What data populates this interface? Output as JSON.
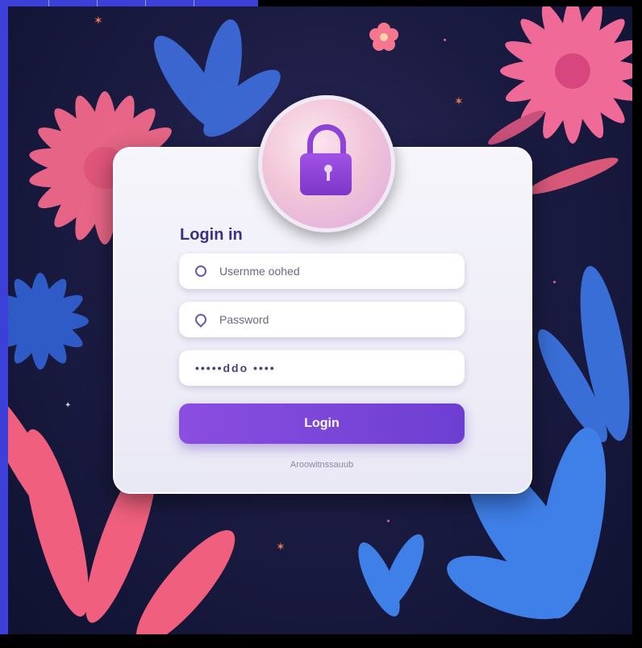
{
  "colors": {
    "accent": "#7b3fd6",
    "title": "#3b2f86",
    "background": "#1c1c44",
    "card": "#f3f2fa"
  },
  "login_form": {
    "title": "Login in",
    "username_placeholder": "Usernme oohed",
    "password_placeholder": "Password",
    "password_value": "•••••ddo ••••",
    "button_label": "Login",
    "footer_link": "Aroowitnssauub"
  },
  "icons": {
    "lock": "lock-icon",
    "username": "shield-icon",
    "password": "location-pin-icon"
  }
}
